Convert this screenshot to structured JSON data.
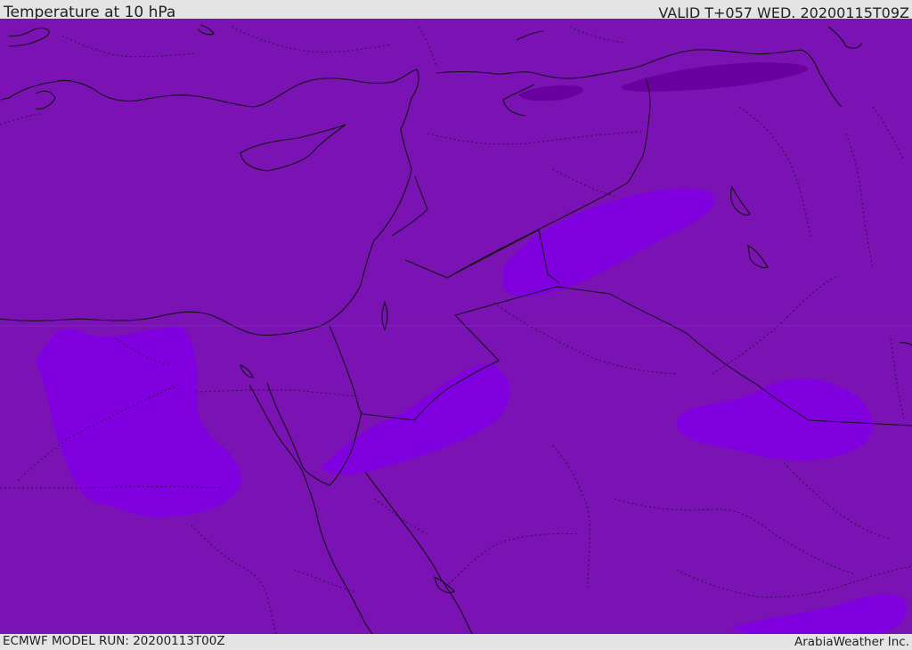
{
  "header": {
    "title": "Temperature at 10 hPa",
    "valid": "VALID T+057 WED. 20200115T09Z"
  },
  "footer": {
    "model_run": "ECMWF MODEL RUN: 20200113T00Z",
    "brand": "ArabiaWeather Inc."
  },
  "colors": {
    "background_field": "#7a12b4",
    "warm_patch": "#8000e0",
    "cold_patch": "#6a009e",
    "coastline": "#111111",
    "header_bar": "#e4e4e4"
  }
}
